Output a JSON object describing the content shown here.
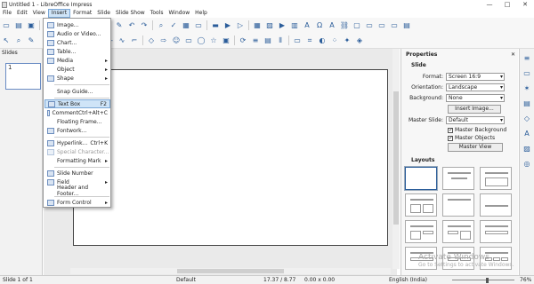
{
  "window": {
    "title": "Untitled 1 - LibreOffice Impress",
    "min": "—",
    "max": "□",
    "close": "✕"
  },
  "menubar": [
    "File",
    "Edit",
    "View",
    "Insert",
    "Format",
    "Slide",
    "Slide Show",
    "Tools",
    "Window",
    "Help"
  ],
  "menu": {
    "items": [
      {
        "label": "Image...",
        "shortcut": "",
        "arrow": false
      },
      {
        "label": "Audio or Video...",
        "shortcut": "",
        "arrow": false
      },
      {
        "label": "Chart...",
        "shortcut": "",
        "arrow": false
      },
      {
        "label": "Table...",
        "shortcut": "",
        "arrow": false
      },
      {
        "label": "Media",
        "shortcut": "",
        "arrow": true
      },
      {
        "label": "Object",
        "shortcut": "",
        "arrow": true
      },
      {
        "label": "Shape",
        "shortcut": "",
        "arrow": true
      },
      {
        "label": "Snap Guide...",
        "shortcut": "",
        "arrow": false
      },
      {
        "label": "Text Box",
        "shortcut": "F2",
        "arrow": false,
        "highlighted": true
      },
      {
        "label": "Comment",
        "shortcut": "Ctrl+Alt+C",
        "arrow": false
      },
      {
        "label": "Floating Frame...",
        "shortcut": "",
        "arrow": false
      },
      {
        "label": "Fontwork...",
        "shortcut": "",
        "arrow": false
      },
      {
        "label": "Hyperlink...",
        "shortcut": "Ctrl+K",
        "arrow": false
      },
      {
        "label": "Special Character...",
        "shortcut": "",
        "arrow": false,
        "disabled": true
      },
      {
        "label": "Formatting Mark",
        "shortcut": "",
        "arrow": true
      },
      {
        "label": "Slide Number",
        "shortcut": "",
        "arrow": false
      },
      {
        "label": "Field",
        "shortcut": "",
        "arrow": true
      },
      {
        "label": "Header and Footer...",
        "shortcut": "",
        "arrow": false
      },
      {
        "label": "Form Control",
        "shortcut": "",
        "arrow": true
      }
    ]
  },
  "slides_pane": {
    "title": "Slides",
    "thumb_number": "1"
  },
  "sidebar": {
    "title": "Properties",
    "close": "✕",
    "section_slide": "Slide",
    "format_label": "Format:",
    "format_value": "Screen 16:9",
    "orientation_label": "Orientation:",
    "orientation_value": "Landscape",
    "background_label": "Background:",
    "background_value": "None",
    "insert_image": "Insert Image...",
    "master_slide_label": "Master Slide:",
    "master_slide_value": "Default",
    "master_background": "Master Background",
    "master_objects": "Master Objects",
    "master_view": "Master View",
    "section_layouts": "Layouts"
  },
  "statusbar": {
    "slide": "Slide 1 of 1",
    "master": "Default",
    "coords": "17.37 / 8.77",
    "size": "0.00 x 0.00",
    "lang": "English (India)",
    "zoom": "76%"
  },
  "watermark": {
    "line1": "Activate Windows",
    "line2": "Go to Settings to activate Windows."
  },
  "colors": {
    "accent": "#2b5d9a",
    "highlight": "#cfe4f7"
  }
}
